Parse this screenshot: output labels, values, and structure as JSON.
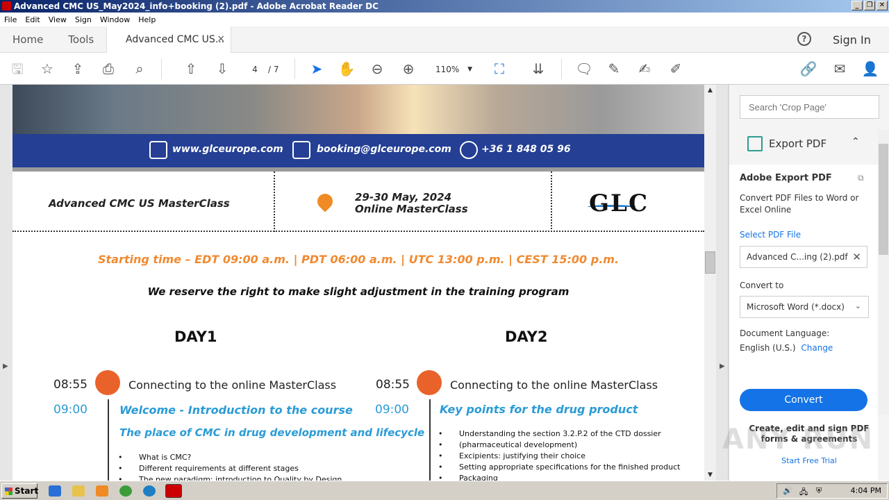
{
  "window": {
    "title": "Advanced CMC US_May2024_info+booking (2).pdf - Adobe Acrobat Reader DC"
  },
  "menu": {
    "items": [
      "File",
      "Edit",
      "View",
      "Sign",
      "Window",
      "Help"
    ]
  },
  "tabs": {
    "home": "Home",
    "tools": "Tools",
    "doc": "Advanced CMC US...",
    "close": "×",
    "help": "?",
    "sign_in": "Sign In"
  },
  "toolbar": {
    "page_current": "4",
    "page_total": "/ 7",
    "zoom": "110%"
  },
  "pdf": {
    "website": "www.glceurope.com",
    "email": "booking@glceurope.com",
    "phone": "+36 1 848 05 96",
    "course": "Advanced CMC US MasterClass",
    "dates": "29-30 May, 2024",
    "format": "Online MasterClass",
    "logo": "GLC",
    "starting": "Starting time – EDT 09:00 a.m. | PDT 06:00 a.m. | UTC 13:00 p.m. | CEST 15:00 p.m.",
    "reserve": "We reserve the right to make slight adjustment in the training program",
    "day1": {
      "title": "DAY1",
      "t1": "08:55",
      "s1": "Connecting to the online MasterClass",
      "t2": "09:00",
      "h1": "Welcome - Introduction to the course",
      "h2": "The place of CMC in drug development and lifecycle",
      "bullets": [
        "What is CMC?",
        "Different requirements at different stages",
        "The new paradigm: introduction to Quality by Design"
      ]
    },
    "day2": {
      "title": "DAY2",
      "t1": "08:55",
      "s1": "Connecting to the online MasterClass",
      "t2": "09:00",
      "h1": "Key points for the drug product",
      "bullets": [
        "Understanding the section 3.2.P.2 of the CTD dossier",
        "(pharmaceutical development)",
        "Excipients: justifying their choice",
        "Setting appropriate specifications for the finished product",
        "Packaging"
      ]
    }
  },
  "panel": {
    "search_placeholder": "Search 'Crop Page'",
    "export_title": "Export PDF",
    "ae_title": "Adobe Export PDF",
    "ae_desc": "Convert PDF Files to Word or Excel Online",
    "select_file": "Select PDF File",
    "file_name": "Advanced C...ing (2).pdf",
    "convert_to": "Convert to",
    "format": "Microsoft Word (*.docx)",
    "doc_lang_label": "Document Language:",
    "doc_lang": "English (U.S.)",
    "change": "Change",
    "convert_btn": "Convert",
    "promo": "Create, edit and sign PDF forms & agreements",
    "trial": "Start Free Trial"
  },
  "taskbar": {
    "start": "Start",
    "time": "4:04 PM"
  },
  "watermark": "ANY RUN"
}
